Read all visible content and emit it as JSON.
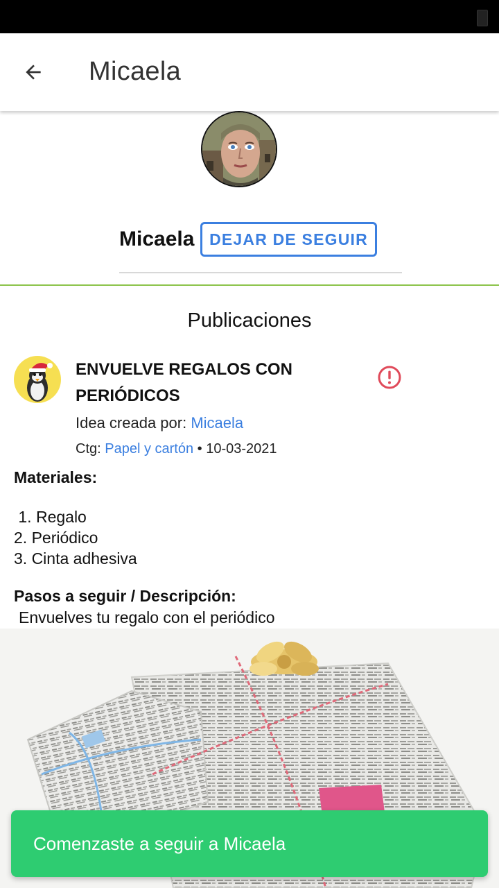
{
  "header": {
    "title": "Micaela",
    "back_icon": "arrow-left-icon"
  },
  "profile": {
    "name": "Micaela",
    "unfollow_label": "DEJAR DE SEGUIR"
  },
  "section": {
    "title": "Publicaciones"
  },
  "post": {
    "title": "ENVUELVE REGALOS CON PERIÓDICOS",
    "created_by_label": "Idea creada por: ",
    "author": "Micaela",
    "category_label": "Ctg: ",
    "category": "Papel y cartón",
    "date_sep": " • ",
    "date": "10-03-2021",
    "materials_title": "Materiales:",
    "materials": [
      " 1. Regalo",
      "2. Periódico",
      "3. Cinta adhesiva"
    ],
    "steps_title": "Pasos a seguir / Descripción:",
    "steps_text": "Envuelves tu regalo con el periódico"
  },
  "toast": {
    "text": "Comenzaste a seguir a Micaela"
  },
  "colors": {
    "accent": "#3b7fe0",
    "divider_green": "#8bc34a",
    "toast_green": "#2ecc71",
    "alert_red": "#e04a5a"
  }
}
